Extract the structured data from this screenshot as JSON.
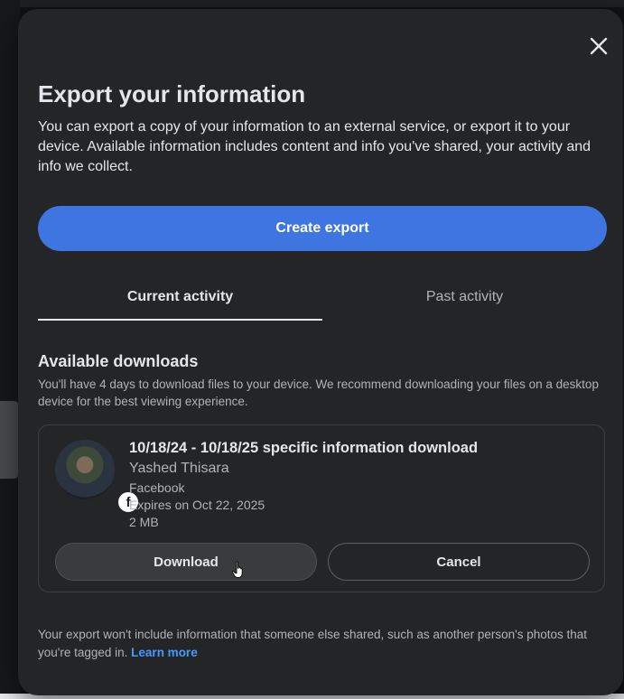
{
  "modal": {
    "title": "Export your information",
    "description": "You can export a copy of your information to an external service, or export it to your device. Available information includes content and info you've shared, your activity and info we collect.",
    "create_export_label": "Create export",
    "close_icon": "close-icon"
  },
  "tabs": [
    {
      "label": "Current activity",
      "selected": true
    },
    {
      "label": "Past activity",
      "selected": false
    }
  ],
  "downloads": {
    "title": "Available downloads",
    "description": "You'll have 4 days to download files to your device. We recommend downloading your files on a desktop device for the best viewing experience.",
    "item": {
      "title": "10/18/24 - 10/18/25 specific information download",
      "name": "Yashed Thisara",
      "source": "Facebook",
      "expires": "Expires on Oct 22, 2025",
      "size": "2 MB",
      "download_label": "Download",
      "cancel_label": "Cancel"
    }
  },
  "footer": {
    "text": "Your export won't include information that someone else shared, such as another person's photos that you're tagged in.",
    "link_label": "Learn more"
  },
  "colors": {
    "modal_bg": "#242526",
    "primary_button": "#3f75e0",
    "link": "#4599ff",
    "text_primary": "#e4e6eb",
    "text_secondary": "#b0b3b8"
  }
}
